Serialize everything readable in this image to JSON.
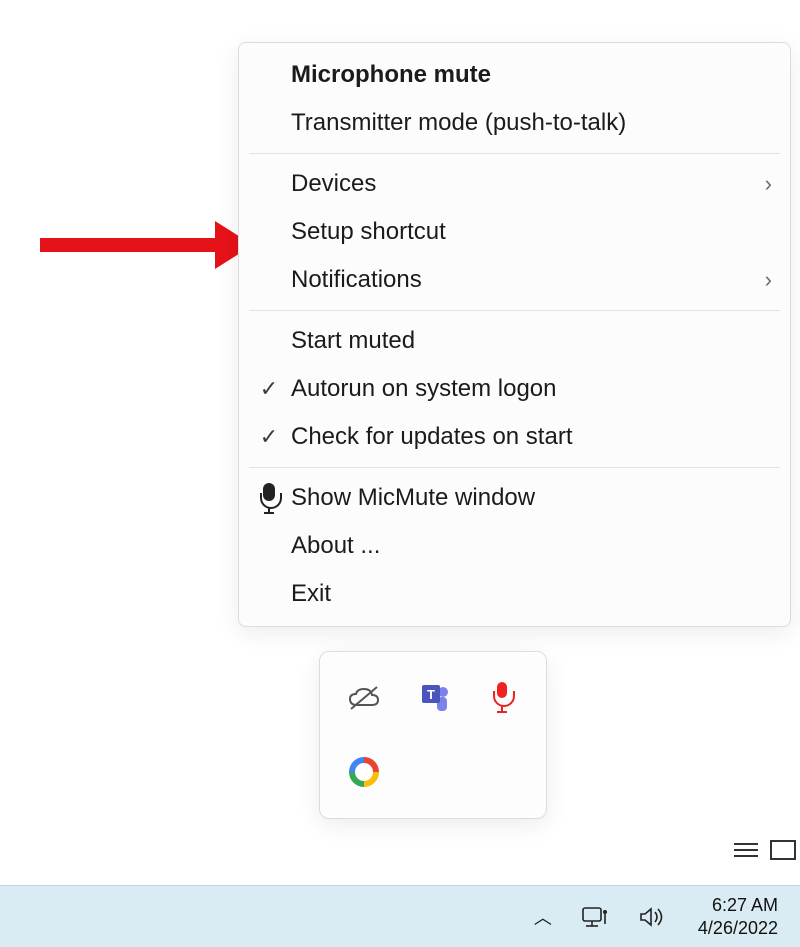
{
  "menu": {
    "title": "Microphone mute",
    "transmitter": "Transmitter mode (push-to-talk)",
    "devices": "Devices",
    "setup_shortcut": "Setup shortcut",
    "notifications": "Notifications",
    "start_muted": "Start muted",
    "autorun": "Autorun on system logon",
    "check_updates": "Check for updates on start",
    "show_window": "Show MicMute window",
    "about": "About ...",
    "exit": "Exit"
  },
  "tray": {
    "cloud": "onedrive-offline-icon",
    "teams": "teams-icon",
    "micmute": "micmute-icon",
    "chrome": "chrome-icon"
  },
  "taskbar": {
    "time": "6:27 AM",
    "date": "4/26/2022"
  }
}
